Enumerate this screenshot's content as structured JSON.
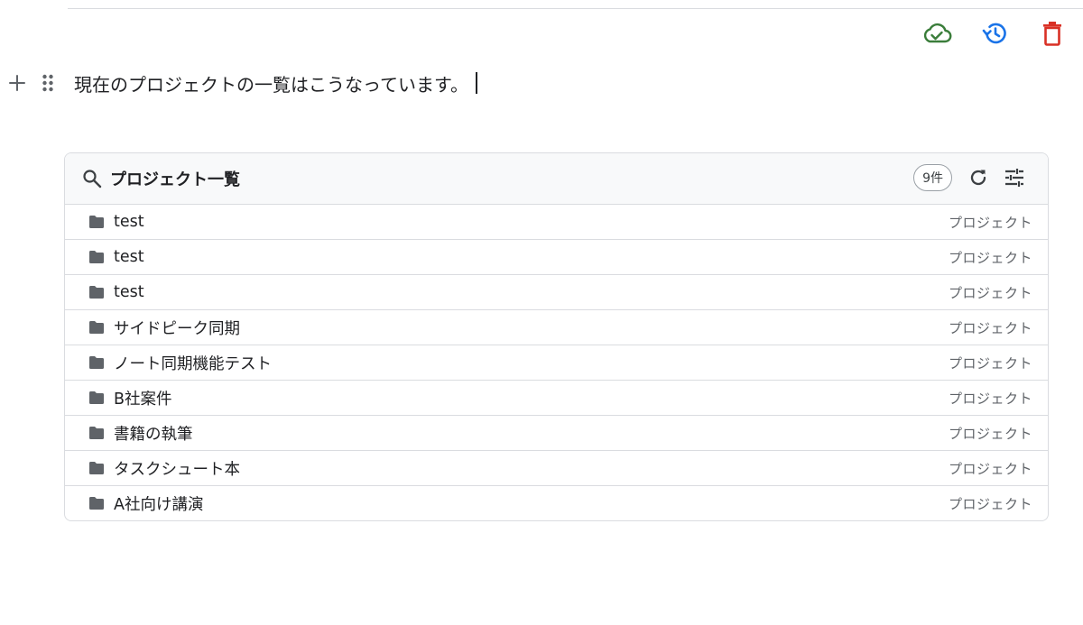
{
  "toolbar": {
    "sync_icon": "cloud-done-icon",
    "history_icon": "history-icon",
    "delete_icon": "trash-icon",
    "sync_color": "#3a7d3a",
    "history_color": "#1a73e8",
    "delete_color": "#d93025"
  },
  "editor": {
    "text": "現在のプロジェクトの一覧はこうなっています。"
  },
  "panel": {
    "title": "プロジェクト一覧",
    "count": "9件",
    "rows": [
      {
        "name": "test",
        "type": "プロジェクト"
      },
      {
        "name": "test",
        "type": "プロジェクト"
      },
      {
        "name": "test",
        "type": "プロジェクト"
      },
      {
        "name": "サイドピーク同期",
        "type": "プロジェクト"
      },
      {
        "name": "ノート同期機能テスト",
        "type": "プロジェクト"
      },
      {
        "name": "B社案件",
        "type": "プロジェクト"
      },
      {
        "name": "書籍の執筆",
        "type": "プロジェクト"
      },
      {
        "name": "タスクシュート本",
        "type": "プロジェクト"
      },
      {
        "name": "A社向け講演",
        "type": "プロジェクト"
      }
    ]
  }
}
